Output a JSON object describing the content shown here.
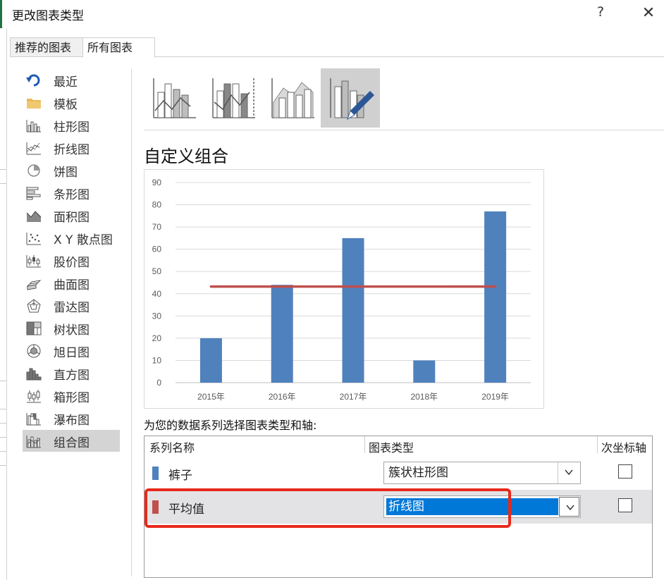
{
  "dialog": {
    "title": "更改图表类型",
    "help_glyph": "?",
    "close_glyph": "✕"
  },
  "tabs": [
    {
      "label": "推荐的图表",
      "active": false
    },
    {
      "label": "所有图表",
      "active": true
    }
  ],
  "chart_types": [
    {
      "label": "最近",
      "icon": "recent-icon"
    },
    {
      "label": "模板",
      "icon": "folder-icon"
    },
    {
      "label": "柱形图",
      "icon": "column-chart-icon"
    },
    {
      "label": "折线图",
      "icon": "line-chart-icon"
    },
    {
      "label": "饼图",
      "icon": "pie-chart-icon"
    },
    {
      "label": "条形图",
      "icon": "bar-chart-icon"
    },
    {
      "label": "面积图",
      "icon": "area-chart-icon"
    },
    {
      "label": "X Y 散点图",
      "icon": "scatter-chart-icon"
    },
    {
      "label": "股价图",
      "icon": "stock-chart-icon"
    },
    {
      "label": "曲面图",
      "icon": "surface-chart-icon"
    },
    {
      "label": "雷达图",
      "icon": "radar-chart-icon"
    },
    {
      "label": "树状图",
      "icon": "treemap-chart-icon"
    },
    {
      "label": "旭日图",
      "icon": "sunburst-chart-icon"
    },
    {
      "label": "直方图",
      "icon": "histogram-chart-icon"
    },
    {
      "label": "箱形图",
      "icon": "box-whisker-chart-icon"
    },
    {
      "label": "瀑布图",
      "icon": "waterfall-chart-icon"
    },
    {
      "label": "组合图",
      "icon": "combo-chart-icon",
      "selected": true
    }
  ],
  "subtypes": [
    {
      "icon": "clustered-column-line-icon",
      "selected": false
    },
    {
      "icon": "clustered-column-line-secondary-axis-icon",
      "selected": false
    },
    {
      "icon": "stacked-area-clustered-column-icon",
      "selected": false
    },
    {
      "icon": "custom-combination-icon",
      "selected": true
    }
  ],
  "combo_heading": "自定义组合",
  "instruction": "为您的数据系列选择图表类型和轴:",
  "grid": {
    "headers": {
      "series": "系列名称",
      "type": "图表类型",
      "secondary": "次坐标轴"
    },
    "rows": [
      {
        "name": "裤子",
        "color": "#4f81bd",
        "type": "簇状柱形图",
        "secondary_checked": false,
        "selected": false
      },
      {
        "name": "平均值",
        "color": "#c0504d",
        "type": "折线图",
        "secondary_checked": false,
        "selected": true
      }
    ]
  },
  "chart_data": {
    "type": "bar",
    "categories": [
      "2015年",
      "2016年",
      "2017年",
      "2018年",
      "2019年"
    ],
    "series": [
      {
        "name": "裤子",
        "type": "bar",
        "color": "#4f81bd",
        "values": [
          20,
          44,
          65,
          10,
          77
        ]
      },
      {
        "name": "平均值",
        "type": "line",
        "color": "#c0504d",
        "values": [
          43.2,
          43.2,
          43.2,
          43.2,
          43.2
        ]
      }
    ],
    "yticks": [
      "0",
      "10",
      "20",
      "30",
      "40",
      "50",
      "60",
      "70",
      "80",
      "90"
    ],
    "ylim": [
      0,
      90
    ],
    "grid": true,
    "title": "",
    "xlabel": "",
    "ylabel": ""
  }
}
